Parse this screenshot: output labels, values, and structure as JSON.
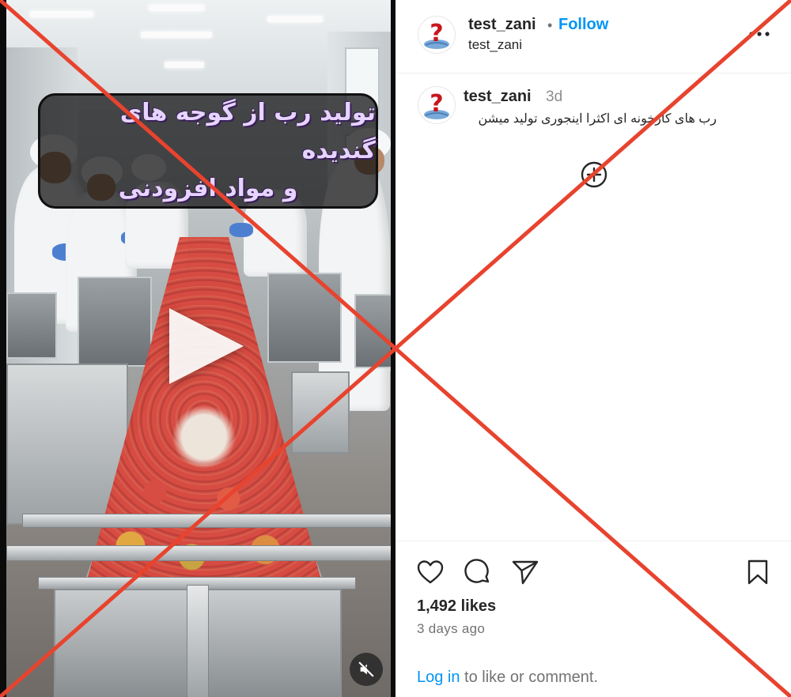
{
  "video": {
    "overlay_text_line1": "تولید رب از گوجه های گندیده",
    "overlay_text_line2": "و مواد افزودنی",
    "play_icon": "play-icon",
    "mute_icon": "speaker-muted-icon"
  },
  "post": {
    "header": {
      "username": "test_zani",
      "separator": "•",
      "follow_label": "Follow",
      "subtitle": "test_zani",
      "more_icon": "more-horizontal-icon"
    },
    "caption": {
      "username": "test_zani",
      "time": "3d",
      "text": "رب های کارخونه ای اکثرا اینجوری تولید میشن"
    },
    "more_comments_icon": "plus-circle-icon",
    "actions": {
      "like_icon": "heart-icon",
      "comment_icon": "comment-icon",
      "share_icon": "send-icon",
      "save_icon": "bookmark-icon"
    },
    "likes": "1,492 likes",
    "posted": "3 days ago",
    "login_link": "Log in",
    "login_rest": " to like or comment."
  },
  "colors": {
    "link_blue": "#0095f6",
    "cross_red": "#e8432e",
    "text_dark": "#262626",
    "text_muted": "#737373"
  }
}
